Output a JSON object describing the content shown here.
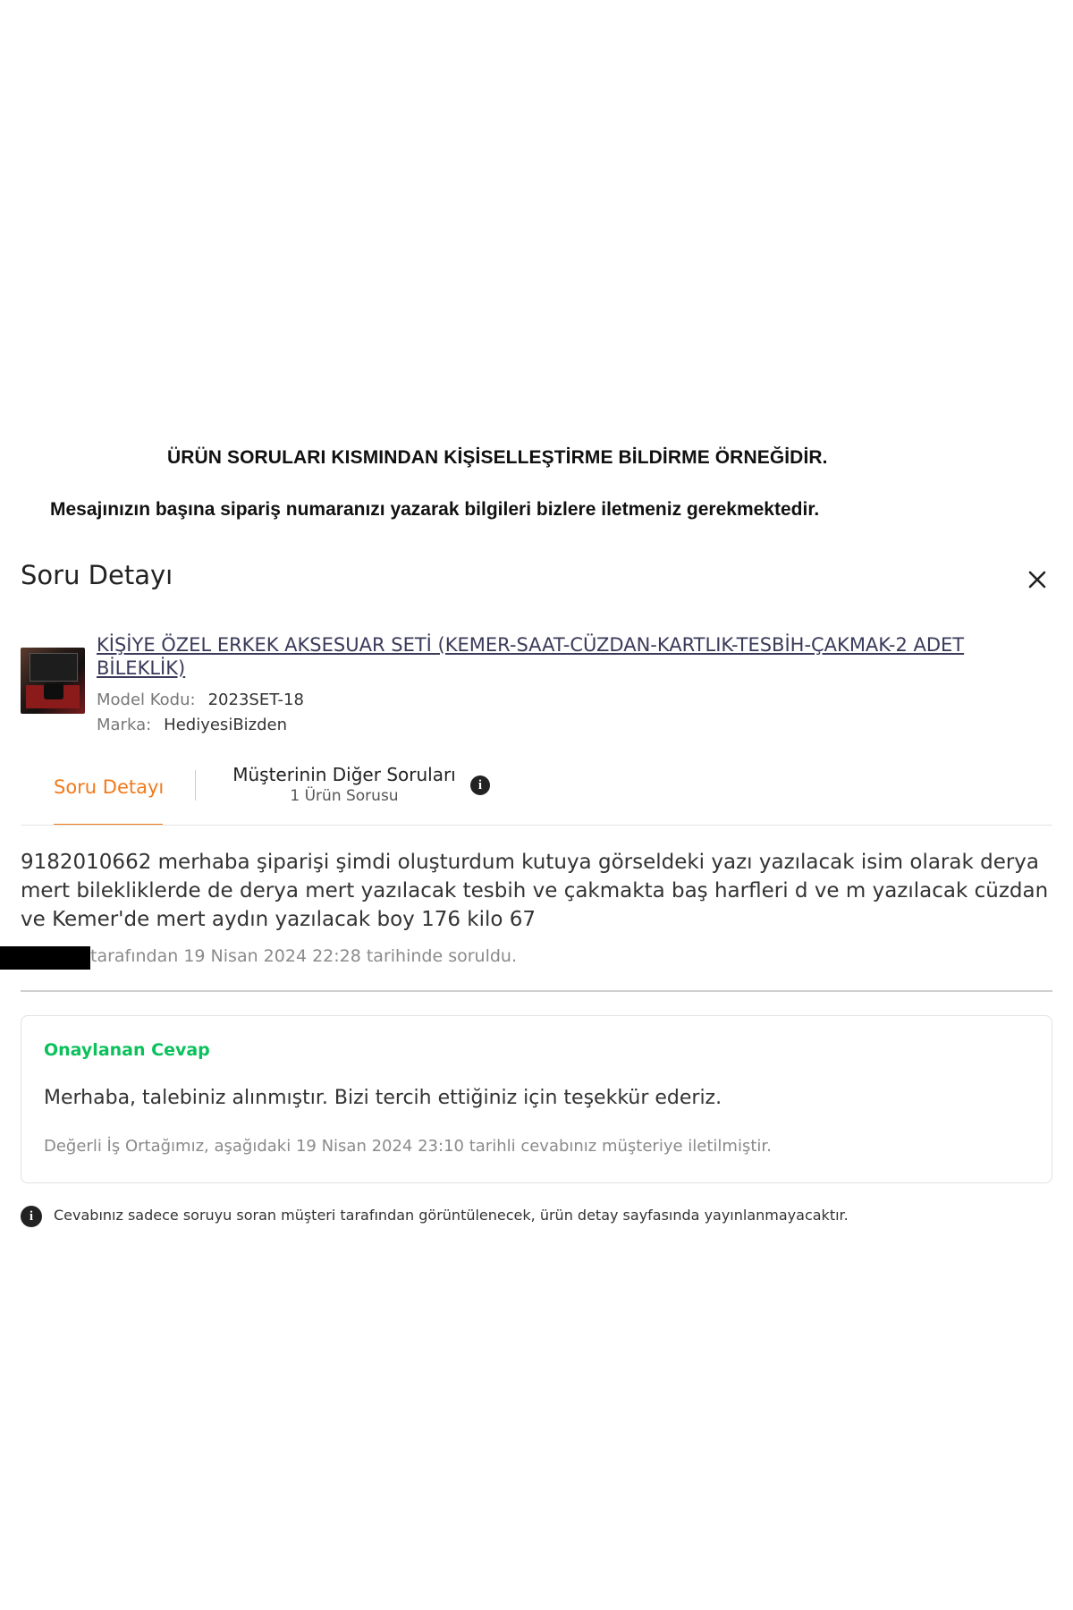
{
  "captions": {
    "line1": "ÜRÜN SORULARI KISMINDAN KİŞİSELLEŞTİRME BİLDİRME ÖRNEĞİDİR.",
    "line2": "Mesajınızın başına sipariş numaranızı yazarak bilgileri bizlere iletmeniz gerekmektedir."
  },
  "modal": {
    "title": "Soru Detayı",
    "close_icon": "close-icon"
  },
  "product": {
    "title": "KİŞİYE ÖZEL ERKEK AKSESUAR SETİ (KEMER-SAAT-CÜZDAN-KARTLIK-TESBİH-ÇAKMAK-2 ADET BİLEKLİK)",
    "model_key": "Model Kodu:",
    "model_value": "2023SET-18",
    "brand_key": "Marka:",
    "brand_value": "HediyesiBizden"
  },
  "tabs": {
    "active_label": "Soru Detayı",
    "other_label": "Müşterinin Diğer Soruları",
    "other_sub": "1 Ürün Sorusu",
    "info_glyph": "i"
  },
  "question": {
    "text": "9182010662 merhaba şiparişi şimdi oluşturdum kutuya görseldeki yazı yazılacak isim olarak derya mert bilekliklerde de derya mert yazılacak tesbih ve çakmakta baş harfleri d ve m yazılacak cüzdan ve Kemer'de mert aydın yazılacak boy 176 kilo 67",
    "asked_by": "tarafından 19 Nisan 2024 22:28 tarihinde soruldu."
  },
  "answer": {
    "label": "Onaylanan Cevap",
    "text": "Merhaba, talebiniz alınmıştır. Bizi tercih ettiğiniz için teşekkür ederiz.",
    "note": "Değerli İş Ortağımız, aşağıdaki 19 Nisan 2024 23:10 tarihli cevabınız müşteriye iletilmiştir."
  },
  "footer": {
    "info_glyph": "i",
    "note": "Cevabınız sadece soruyu soran müşteri tarafından görüntülenecek, ürün detay sayfasında yayınlanmayacaktır."
  },
  "colors": {
    "accent": "#f27a1a",
    "approved": "#0bc15c",
    "text": "#333333",
    "muted": "#8a8a8a"
  }
}
